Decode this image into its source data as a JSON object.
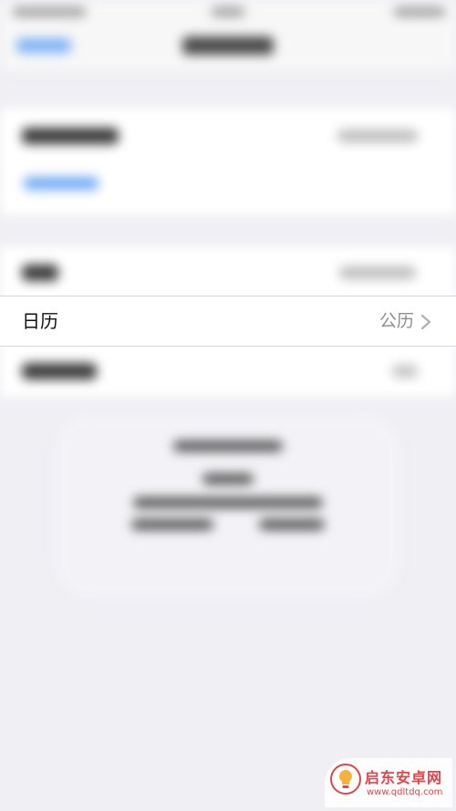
{
  "settings": {
    "calendar_row": {
      "label": "日历",
      "value": "公历",
      "chevron_icon": "chevron-right-icon"
    }
  },
  "watermark": {
    "name": "启东安卓网",
    "url": "www.qdltdq.com",
    "logo_icon": "lightbulb-icon",
    "accent_color": "#e0454a"
  },
  "colors": {
    "background": "#efeff4",
    "cell": "#ffffff",
    "link_blue": "#6fa8f3"
  }
}
